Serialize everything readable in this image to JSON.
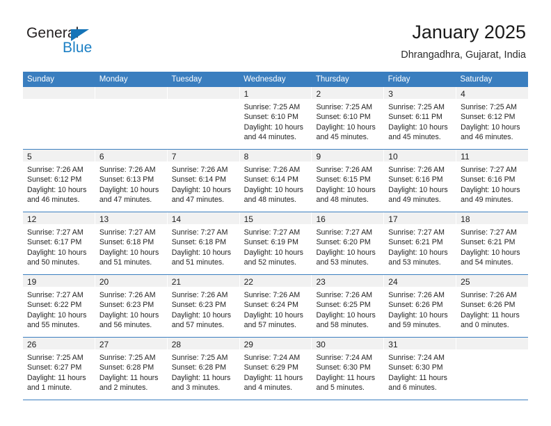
{
  "brand": {
    "name_part1": "General",
    "name_part2": "Blue",
    "accent_color": "#1b7fc4",
    "triangle_color": "#1574b8"
  },
  "header": {
    "title": "January 2025",
    "location": "Dhrangadhra, Gujarat, India"
  },
  "theme": {
    "header_row_color": "#3a7ebf",
    "daynum_strip_color": "#f1f1f1",
    "text_color": "#232323"
  },
  "weekdays": [
    "Sunday",
    "Monday",
    "Tuesday",
    "Wednesday",
    "Thursday",
    "Friday",
    "Saturday"
  ],
  "weeks": [
    [
      {
        "day": "",
        "empty": true,
        "sunrise": "",
        "sunset": "",
        "daylight1": "",
        "daylight2": ""
      },
      {
        "day": "",
        "empty": true,
        "sunrise": "",
        "sunset": "",
        "daylight1": "",
        "daylight2": ""
      },
      {
        "day": "",
        "empty": true,
        "sunrise": "",
        "sunset": "",
        "daylight1": "",
        "daylight2": ""
      },
      {
        "day": "1",
        "empty": false,
        "sunrise": "Sunrise: 7:25 AM",
        "sunset": "Sunset: 6:10 PM",
        "daylight1": "Daylight: 10 hours",
        "daylight2": "and 44 minutes."
      },
      {
        "day": "2",
        "empty": false,
        "sunrise": "Sunrise: 7:25 AM",
        "sunset": "Sunset: 6:10 PM",
        "daylight1": "Daylight: 10 hours",
        "daylight2": "and 45 minutes."
      },
      {
        "day": "3",
        "empty": false,
        "sunrise": "Sunrise: 7:25 AM",
        "sunset": "Sunset: 6:11 PM",
        "daylight1": "Daylight: 10 hours",
        "daylight2": "and 45 minutes."
      },
      {
        "day": "4",
        "empty": false,
        "sunrise": "Sunrise: 7:25 AM",
        "sunset": "Sunset: 6:12 PM",
        "daylight1": "Daylight: 10 hours",
        "daylight2": "and 46 minutes."
      }
    ],
    [
      {
        "day": "5",
        "empty": false,
        "sunrise": "Sunrise: 7:26 AM",
        "sunset": "Sunset: 6:12 PM",
        "daylight1": "Daylight: 10 hours",
        "daylight2": "and 46 minutes."
      },
      {
        "day": "6",
        "empty": false,
        "sunrise": "Sunrise: 7:26 AM",
        "sunset": "Sunset: 6:13 PM",
        "daylight1": "Daylight: 10 hours",
        "daylight2": "and 47 minutes."
      },
      {
        "day": "7",
        "empty": false,
        "sunrise": "Sunrise: 7:26 AM",
        "sunset": "Sunset: 6:14 PM",
        "daylight1": "Daylight: 10 hours",
        "daylight2": "and 47 minutes."
      },
      {
        "day": "8",
        "empty": false,
        "sunrise": "Sunrise: 7:26 AM",
        "sunset": "Sunset: 6:14 PM",
        "daylight1": "Daylight: 10 hours",
        "daylight2": "and 48 minutes."
      },
      {
        "day": "9",
        "empty": false,
        "sunrise": "Sunrise: 7:26 AM",
        "sunset": "Sunset: 6:15 PM",
        "daylight1": "Daylight: 10 hours",
        "daylight2": "and 48 minutes."
      },
      {
        "day": "10",
        "empty": false,
        "sunrise": "Sunrise: 7:26 AM",
        "sunset": "Sunset: 6:16 PM",
        "daylight1": "Daylight: 10 hours",
        "daylight2": "and 49 minutes."
      },
      {
        "day": "11",
        "empty": false,
        "sunrise": "Sunrise: 7:27 AM",
        "sunset": "Sunset: 6:16 PM",
        "daylight1": "Daylight: 10 hours",
        "daylight2": "and 49 minutes."
      }
    ],
    [
      {
        "day": "12",
        "empty": false,
        "sunrise": "Sunrise: 7:27 AM",
        "sunset": "Sunset: 6:17 PM",
        "daylight1": "Daylight: 10 hours",
        "daylight2": "and 50 minutes."
      },
      {
        "day": "13",
        "empty": false,
        "sunrise": "Sunrise: 7:27 AM",
        "sunset": "Sunset: 6:18 PM",
        "daylight1": "Daylight: 10 hours",
        "daylight2": "and 51 minutes."
      },
      {
        "day": "14",
        "empty": false,
        "sunrise": "Sunrise: 7:27 AM",
        "sunset": "Sunset: 6:18 PM",
        "daylight1": "Daylight: 10 hours",
        "daylight2": "and 51 minutes."
      },
      {
        "day": "15",
        "empty": false,
        "sunrise": "Sunrise: 7:27 AM",
        "sunset": "Sunset: 6:19 PM",
        "daylight1": "Daylight: 10 hours",
        "daylight2": "and 52 minutes."
      },
      {
        "day": "16",
        "empty": false,
        "sunrise": "Sunrise: 7:27 AM",
        "sunset": "Sunset: 6:20 PM",
        "daylight1": "Daylight: 10 hours",
        "daylight2": "and 53 minutes."
      },
      {
        "day": "17",
        "empty": false,
        "sunrise": "Sunrise: 7:27 AM",
        "sunset": "Sunset: 6:21 PM",
        "daylight1": "Daylight: 10 hours",
        "daylight2": "and 53 minutes."
      },
      {
        "day": "18",
        "empty": false,
        "sunrise": "Sunrise: 7:27 AM",
        "sunset": "Sunset: 6:21 PM",
        "daylight1": "Daylight: 10 hours",
        "daylight2": "and 54 minutes."
      }
    ],
    [
      {
        "day": "19",
        "empty": false,
        "sunrise": "Sunrise: 7:27 AM",
        "sunset": "Sunset: 6:22 PM",
        "daylight1": "Daylight: 10 hours",
        "daylight2": "and 55 minutes."
      },
      {
        "day": "20",
        "empty": false,
        "sunrise": "Sunrise: 7:26 AM",
        "sunset": "Sunset: 6:23 PM",
        "daylight1": "Daylight: 10 hours",
        "daylight2": "and 56 minutes."
      },
      {
        "day": "21",
        "empty": false,
        "sunrise": "Sunrise: 7:26 AM",
        "sunset": "Sunset: 6:23 PM",
        "daylight1": "Daylight: 10 hours",
        "daylight2": "and 57 minutes."
      },
      {
        "day": "22",
        "empty": false,
        "sunrise": "Sunrise: 7:26 AM",
        "sunset": "Sunset: 6:24 PM",
        "daylight1": "Daylight: 10 hours",
        "daylight2": "and 57 minutes."
      },
      {
        "day": "23",
        "empty": false,
        "sunrise": "Sunrise: 7:26 AM",
        "sunset": "Sunset: 6:25 PM",
        "daylight1": "Daylight: 10 hours",
        "daylight2": "and 58 minutes."
      },
      {
        "day": "24",
        "empty": false,
        "sunrise": "Sunrise: 7:26 AM",
        "sunset": "Sunset: 6:26 PM",
        "daylight1": "Daylight: 10 hours",
        "daylight2": "and 59 minutes."
      },
      {
        "day": "25",
        "empty": false,
        "sunrise": "Sunrise: 7:26 AM",
        "sunset": "Sunset: 6:26 PM",
        "daylight1": "Daylight: 11 hours",
        "daylight2": "and 0 minutes."
      }
    ],
    [
      {
        "day": "26",
        "empty": false,
        "sunrise": "Sunrise: 7:25 AM",
        "sunset": "Sunset: 6:27 PM",
        "daylight1": "Daylight: 11 hours",
        "daylight2": "and 1 minute."
      },
      {
        "day": "27",
        "empty": false,
        "sunrise": "Sunrise: 7:25 AM",
        "sunset": "Sunset: 6:28 PM",
        "daylight1": "Daylight: 11 hours",
        "daylight2": "and 2 minutes."
      },
      {
        "day": "28",
        "empty": false,
        "sunrise": "Sunrise: 7:25 AM",
        "sunset": "Sunset: 6:28 PM",
        "daylight1": "Daylight: 11 hours",
        "daylight2": "and 3 minutes."
      },
      {
        "day": "29",
        "empty": false,
        "sunrise": "Sunrise: 7:24 AM",
        "sunset": "Sunset: 6:29 PM",
        "daylight1": "Daylight: 11 hours",
        "daylight2": "and 4 minutes."
      },
      {
        "day": "30",
        "empty": false,
        "sunrise": "Sunrise: 7:24 AM",
        "sunset": "Sunset: 6:30 PM",
        "daylight1": "Daylight: 11 hours",
        "daylight2": "and 5 minutes."
      },
      {
        "day": "31",
        "empty": false,
        "sunrise": "Sunrise: 7:24 AM",
        "sunset": "Sunset: 6:30 PM",
        "daylight1": "Daylight: 11 hours",
        "daylight2": "and 6 minutes."
      },
      {
        "day": "",
        "empty": true,
        "sunrise": "",
        "sunset": "",
        "daylight1": "",
        "daylight2": ""
      }
    ]
  ]
}
